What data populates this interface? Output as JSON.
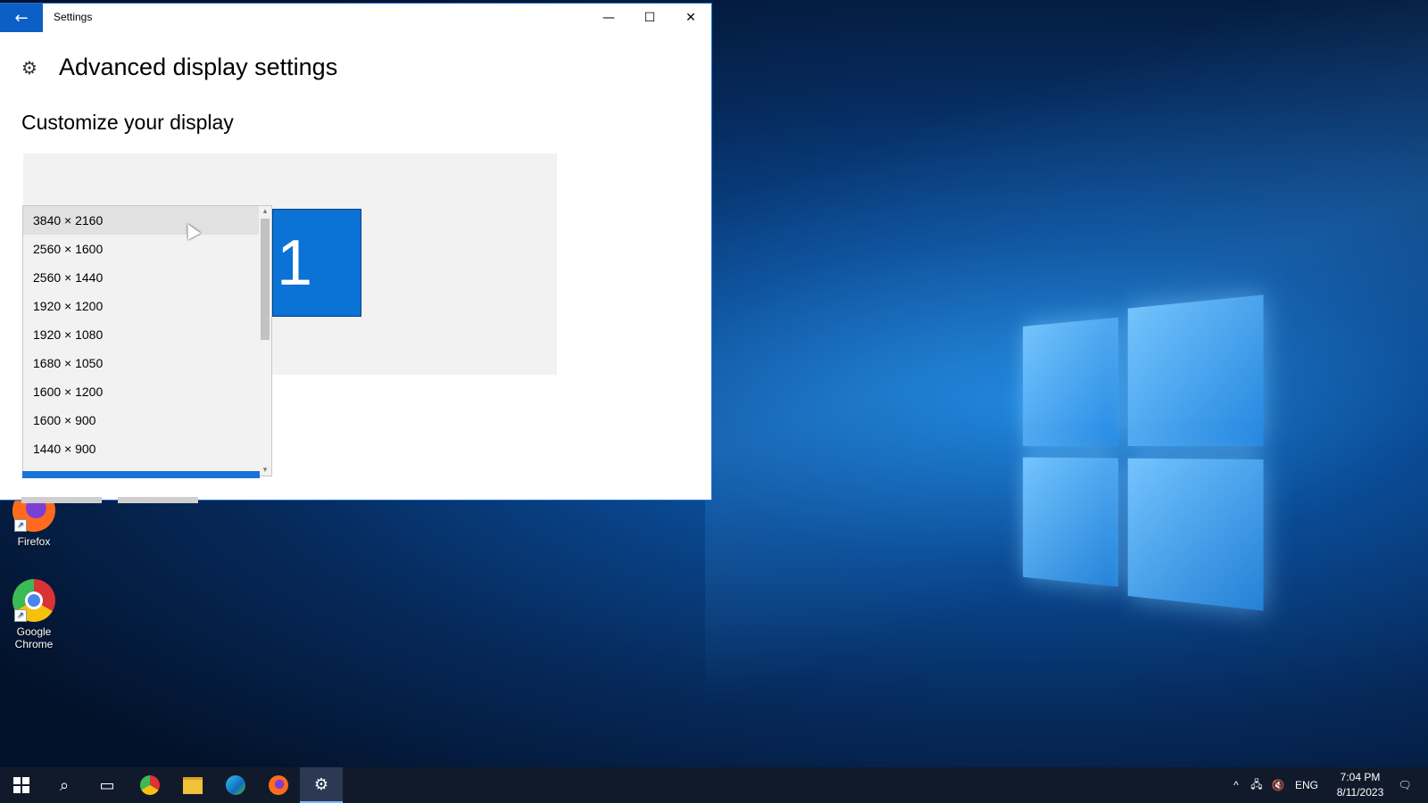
{
  "window": {
    "title": "Settings",
    "back_label": "←",
    "minimize_label": "—",
    "maximize_label": "☐",
    "close_label": "✕"
  },
  "page": {
    "title": "Advanced display settings",
    "section_title": "Customize your display",
    "monitor_label": "1"
  },
  "resolution_dropdown": {
    "options": [
      "3840 × 2160",
      "2560 × 1600",
      "2560 × 1440",
      "1920 × 1200",
      "1920 × 1080",
      "1680 × 1050",
      "1600 × 1200",
      "1600 × 900",
      "1440 × 900"
    ],
    "highlighted_index": 0
  },
  "desktop": {
    "icons": [
      {
        "label": "Firefox"
      },
      {
        "label": "Google Chrome"
      }
    ]
  },
  "taskbar": {
    "language": "ENG",
    "time": "7:04 PM",
    "date": "8/11/2023"
  }
}
